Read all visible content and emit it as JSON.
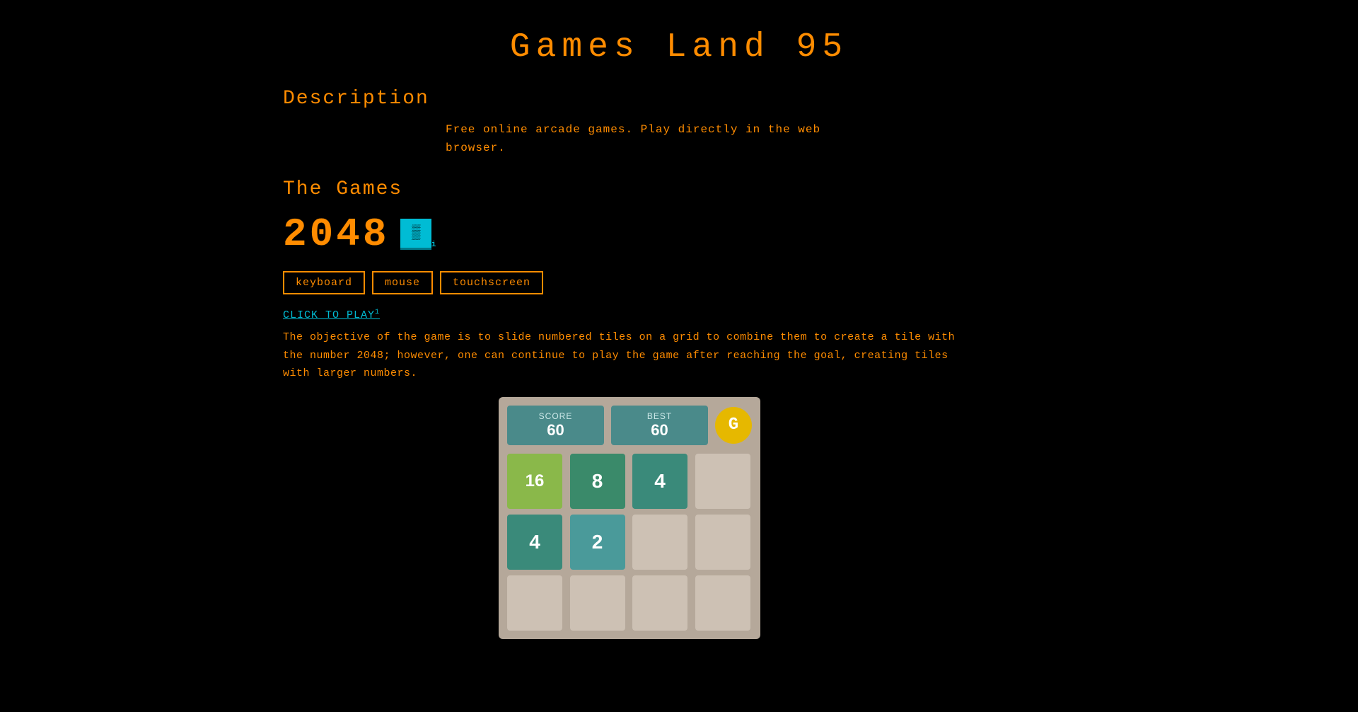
{
  "site": {
    "title": "Games  Land  95"
  },
  "description_section": {
    "heading": "Description",
    "text_line1": "Free online arcade games. Play directly in the web",
    "text_line2": "browser."
  },
  "games_section": {
    "heading": "The Games",
    "game": {
      "title": "2048",
      "controls": [
        "keyboard",
        "mouse",
        "touchscreen"
      ],
      "click_to_play": "CLICK TO PLAY",
      "description_line1": "The objective of the game is to slide numbered tiles on a grid to combine them to create a tile with",
      "description_line2": "the number 2048; however, one can continue to play the game after reaching the goal, creating tiles",
      "description_line3": "with larger numbers.",
      "preview": {
        "score_label": "SCORE",
        "score_value": "60",
        "best_label": "BEST",
        "best_value": "60",
        "new_game_icon": "G",
        "grid": [
          {
            "value": "16",
            "type": "tile-16"
          },
          {
            "value": "8",
            "type": "tile-8"
          },
          {
            "value": "4",
            "type": "tile-4"
          },
          {
            "value": "",
            "type": "tile-empty"
          },
          {
            "value": "4",
            "type": "tile-4"
          },
          {
            "value": "2",
            "type": "tile-2"
          },
          {
            "value": "",
            "type": "tile-empty"
          },
          {
            "value": "",
            "type": "tile-empty"
          },
          {
            "value": "",
            "type": "tile-empty"
          },
          {
            "value": "",
            "type": "tile-empty"
          },
          {
            "value": "",
            "type": "tile-empty"
          },
          {
            "value": "",
            "type": "tile-empty"
          }
        ]
      }
    }
  }
}
